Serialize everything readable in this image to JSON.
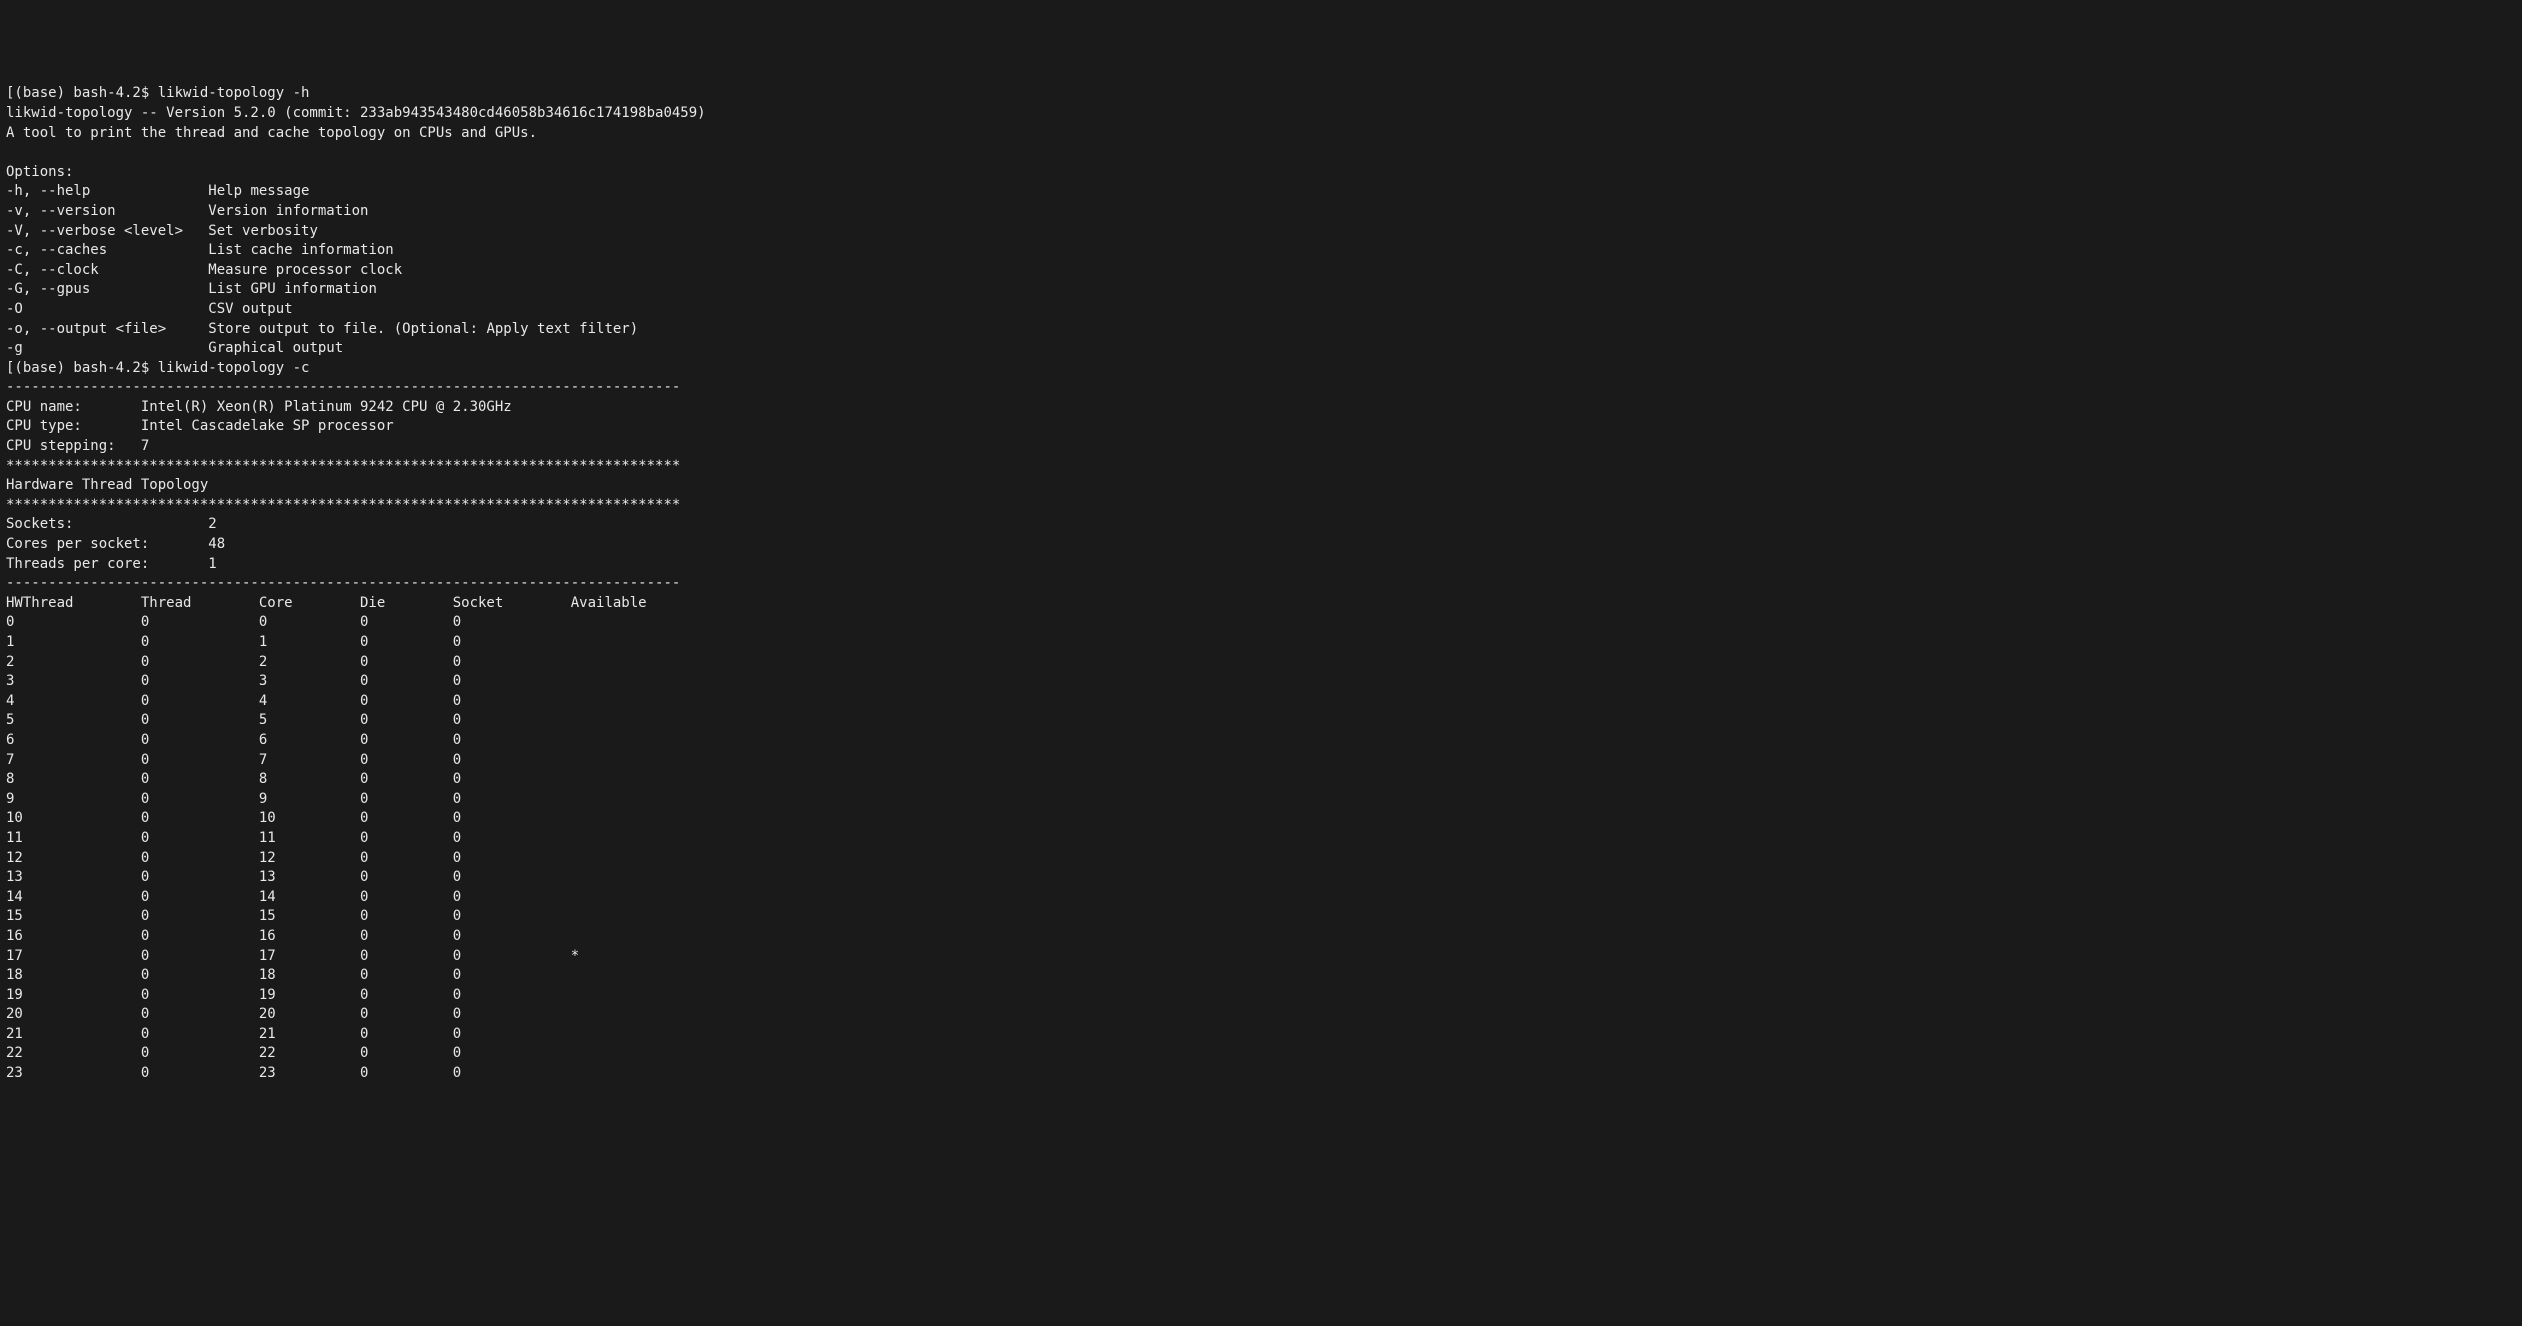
{
  "prompt1": "[(base) bash-4.2$ likwid-topology -h",
  "version_line": "likwid-topology -- Version 5.2.0 (commit: 233ab943543480cd46058b34616c174198ba0459)",
  "description": "A tool to print the thread and cache topology on CPUs and GPUs.",
  "blank1": "",
  "options_header": "Options:",
  "options": [
    "-h, --help\t\tHelp message",
    "-v, --version\t\tVersion information",
    "-V, --verbose <level>\tSet verbosity",
    "-c, --caches\t\tList cache information",
    "-C, --clock\t\tMeasure processor clock",
    "-G, --gpus\t\tList GPU information",
    "-O\t\t\tCSV output",
    "-o, --output <file>\tStore output to file. (Optional: Apply text filter)",
    "-g\t\t\tGraphical output"
  ],
  "prompt2": "[(base) bash-4.2$ likwid-topology -c",
  "divider1": "--------------------------------------------------------------------------------",
  "cpu_info": [
    "CPU name:\tIntel(R) Xeon(R) Platinum 9242 CPU @ 2.30GHz",
    "CPU type:\tIntel Cascadelake SP processor",
    "CPU stepping:\t7"
  ],
  "stars1": "********************************************************************************",
  "hw_thread_header": "Hardware Thread Topology",
  "stars2": "********************************************************************************",
  "socket_info": [
    "Sockets:\t\t2",
    "Cores per socket:\t48",
    "Threads per core:\t1"
  ],
  "divider2": "--------------------------------------------------------------------------------",
  "table": {
    "header": [
      "HWThread",
      "Thread",
      "Core",
      "Die",
      "Socket",
      "Available"
    ],
    "rows": [
      [
        0,
        0,
        0,
        0,
        0,
        ""
      ],
      [
        1,
        0,
        1,
        0,
        0,
        ""
      ],
      [
        2,
        0,
        2,
        0,
        0,
        ""
      ],
      [
        3,
        0,
        3,
        0,
        0,
        ""
      ],
      [
        4,
        0,
        4,
        0,
        0,
        ""
      ],
      [
        5,
        0,
        5,
        0,
        0,
        ""
      ],
      [
        6,
        0,
        6,
        0,
        0,
        ""
      ],
      [
        7,
        0,
        7,
        0,
        0,
        ""
      ],
      [
        8,
        0,
        8,
        0,
        0,
        ""
      ],
      [
        9,
        0,
        9,
        0,
        0,
        ""
      ],
      [
        10,
        0,
        10,
        0,
        0,
        ""
      ],
      [
        11,
        0,
        11,
        0,
        0,
        ""
      ],
      [
        12,
        0,
        12,
        0,
        0,
        ""
      ],
      [
        13,
        0,
        13,
        0,
        0,
        ""
      ],
      [
        14,
        0,
        14,
        0,
        0,
        ""
      ],
      [
        15,
        0,
        15,
        0,
        0,
        ""
      ],
      [
        16,
        0,
        16,
        0,
        0,
        ""
      ],
      [
        17,
        0,
        17,
        0,
        0,
        "*"
      ],
      [
        18,
        0,
        18,
        0,
        0,
        ""
      ],
      [
        19,
        0,
        19,
        0,
        0,
        ""
      ],
      [
        20,
        0,
        20,
        0,
        0,
        ""
      ],
      [
        21,
        0,
        21,
        0,
        0,
        ""
      ],
      [
        22,
        0,
        22,
        0,
        0,
        ""
      ],
      [
        23,
        0,
        23,
        0,
        0,
        ""
      ]
    ]
  }
}
